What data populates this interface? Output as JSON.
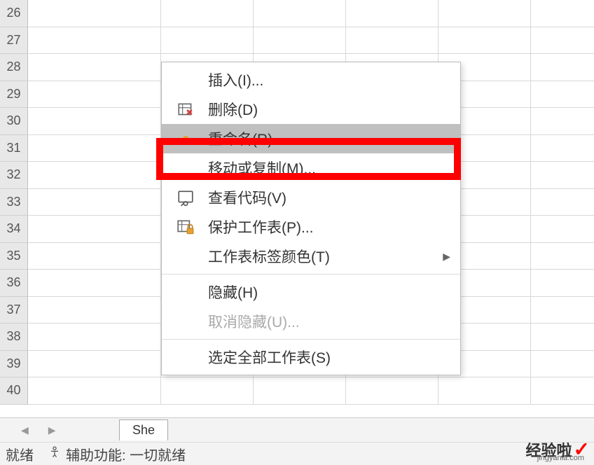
{
  "rows": [
    "26",
    "27",
    "28",
    "29",
    "30",
    "31",
    "32",
    "33",
    "34",
    "35",
    "36",
    "37",
    "38",
    "39",
    "40"
  ],
  "menu": {
    "insert": "插入(I)...",
    "delete": "删除(D)",
    "rename": "重命名(R)",
    "move_copy": "移动或复制(M)...",
    "view_code": "查看代码(V)",
    "protect_sheet": "保护工作表(P)...",
    "tab_color": "工作表标签颜色(T)",
    "hide": "隐藏(H)",
    "unhide": "取消隐藏(U)...",
    "select_all": "选定全部工作表(S)"
  },
  "sheet_tab": "She",
  "status": {
    "ready": "就绪",
    "accessibility": "辅助功能: 一切就绪"
  },
  "watermark": {
    "text": "经验啦",
    "url": "jingyanla.com"
  }
}
